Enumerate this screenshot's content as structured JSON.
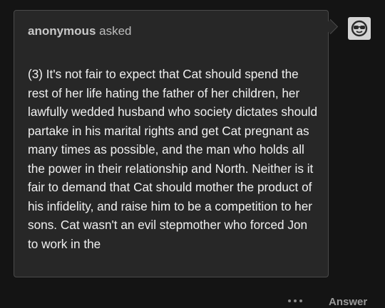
{
  "ask": {
    "asker_name": "anonymous",
    "asker_verb": "asked",
    "body": "(3) It's not fair to expect that Cat should spend the rest of her life hating the father of her children, her lawfully wedded husband who society dictates should partake in his marital rights and get Cat pregnant as many times as possible, and the man who holds all the power in their relationship and North. Neither is it fair to demand that Cat should mother the product of his infidelity, and raise him to be a competition to her sons. Cat wasn't an evil stepmother who forced Jon to work in the"
  },
  "avatar": {
    "icon": "sunglasses-face-icon"
  },
  "footer": {
    "more_icon": "ellipsis-icon",
    "answer_label": "Answer"
  }
}
